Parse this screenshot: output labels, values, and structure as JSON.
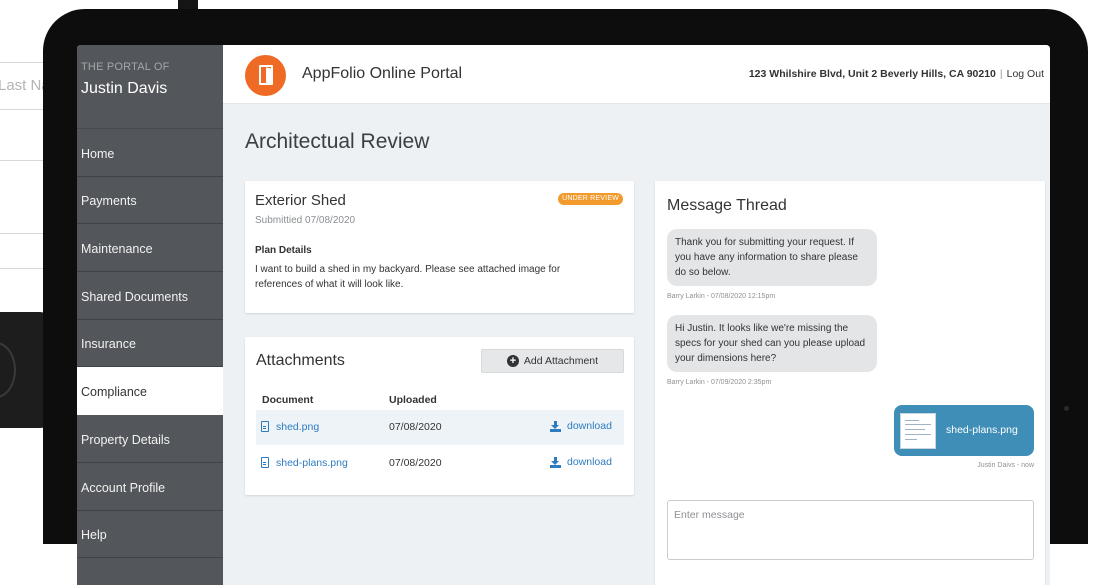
{
  "background": {
    "form_placeholder": "Last Na"
  },
  "sidebar": {
    "kicker": "THE PORTAL OF",
    "user_name": "Justin Davis",
    "items": [
      {
        "label": "Home",
        "active": false
      },
      {
        "label": "Payments",
        "active": false
      },
      {
        "label": "Maintenance",
        "active": false
      },
      {
        "label": "Shared Documents",
        "active": false
      },
      {
        "label": "Insurance",
        "active": false
      },
      {
        "label": "Compliance",
        "active": true
      },
      {
        "label": "Property Details",
        "active": false
      },
      {
        "label": "Account Profile",
        "active": false
      },
      {
        "label": "Help",
        "active": false
      }
    ]
  },
  "header": {
    "logo_icon": "door-icon",
    "app_title": "AppFolio Online Portal",
    "address": "123 Whilshire Blvd, Unit 2 Beverly Hills, CA 90210",
    "separator": "|",
    "logout_label": "Log Out"
  },
  "page": {
    "title": "Architectual Review"
  },
  "request": {
    "title": "Exterior Shed",
    "submitted": "Submittied 07/08/2020",
    "status_badge": "UNDER REVIEW",
    "plan_label": "Plan Details",
    "plan_text": "I want to build a shed in my backyard.  Please see attached image for references of what it will look like."
  },
  "attachments": {
    "title": "Attachments",
    "add_button_label": "Add Attachment",
    "columns": [
      "Document",
      "Uploaded"
    ],
    "rows": [
      {
        "name": "shed.png",
        "uploaded": "07/08/2020",
        "action": "download"
      },
      {
        "name": "shed-plans.png",
        "uploaded": "07/08/2020",
        "action": "download"
      }
    ]
  },
  "messages": {
    "title": "Message Thread",
    "thread": [
      {
        "text": "Thank you for submitting your request. If you have any information to share please do so below.",
        "meta": "Barry Larkin - 07/08/2020 12:15pm"
      },
      {
        "text": "Hi Justin. It looks like we're missing the specs for your shed can you please upload your dimensions here?",
        "meta": "Barry Larkin - 07/09/2020 2:35pm"
      }
    ],
    "outgoing": {
      "file_name": "shed-plans.png",
      "meta": "Justin Daivs - now"
    },
    "input_placeholder": "Enter message"
  },
  "colors": {
    "sidebar": "#53565a",
    "accent": "#ef6a24",
    "link": "#2e7cc0",
    "badge": "#f39a2c",
    "outgoing_bubble": "#3f8eb8"
  }
}
